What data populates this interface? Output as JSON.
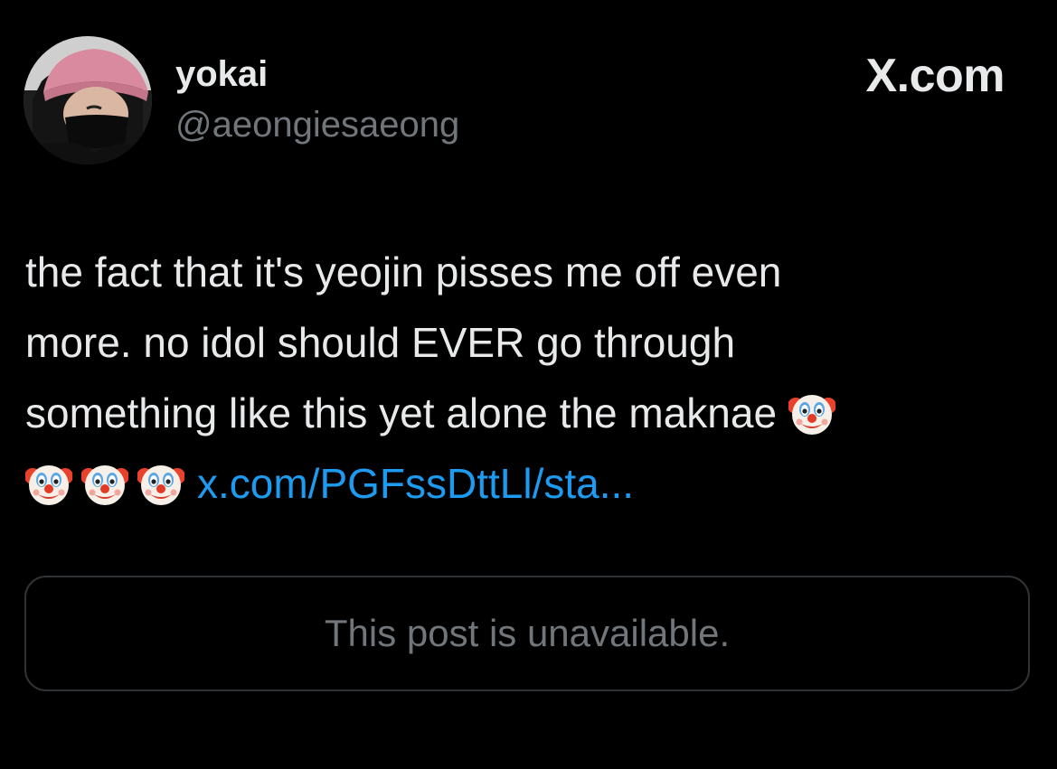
{
  "author": {
    "display_name": "yokai",
    "handle": "@aeongiesaeong",
    "avatar_icon": "profile-photo"
  },
  "brand": {
    "label": "X.com"
  },
  "post": {
    "line1": "the fact that it's yeojin pisses me off even",
    "line2": "more. no idol should EVER go through",
    "line3": "something like this yet alone the maknae",
    "emoji_icon": "clown-face-emoji",
    "link_text": "x.com/PGFssDttLl/sta..."
  },
  "quoted_post": {
    "message": "This post is unavailable."
  },
  "colors": {
    "background": "#000000",
    "text": "#e7e9ea",
    "secondary": "#71767b",
    "link": "#1d9bf0",
    "card_border": "#2f3336"
  }
}
